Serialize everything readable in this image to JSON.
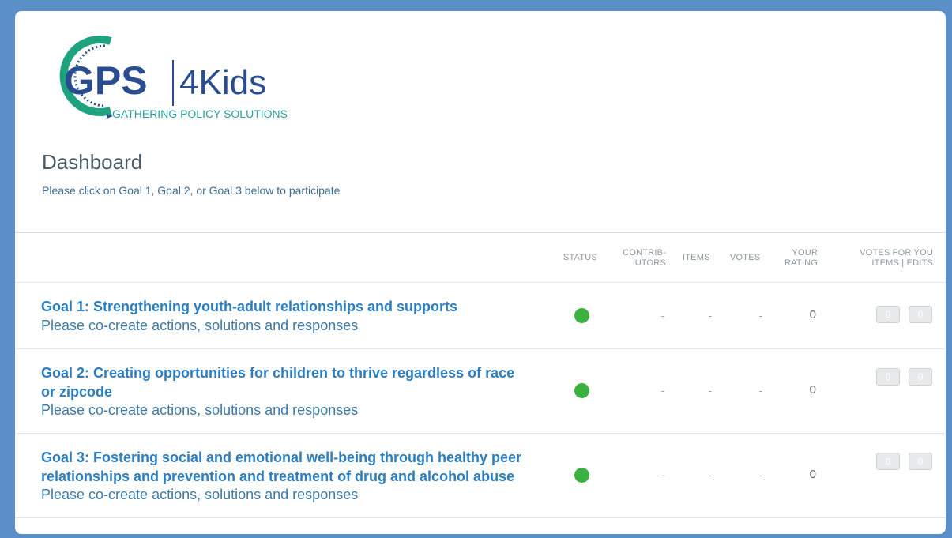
{
  "brand": {
    "logo_main": "GPS",
    "logo_secondary": "4Kids",
    "tagline": "GATHERING POLICY SOLUTIONS",
    "colors": {
      "navy": "#2a4d8f",
      "teal": "#1fa37f",
      "tagline": "#2b9f9d"
    }
  },
  "page": {
    "title": "Dashboard",
    "subtitle": "Please click on Goal 1, Goal 2, or Goal 3 below to participate"
  },
  "table": {
    "headers": {
      "status": "STATUS",
      "contributors_1": "CONTRIB-",
      "contributors_2": "UTORS",
      "items": "ITEMS",
      "votes": "VOTES",
      "rating_1": "YOUR",
      "rating_2": "RATING",
      "votes_for_you_1": "VOTES FOR YOU",
      "votes_for_you_2": "ITEMS | EDITS"
    },
    "rows": [
      {
        "title_line1": "Goal 1: Strengthening youth-adult relationships and supports",
        "title_line2": "",
        "subtitle": "Please co-create actions, solutions and responses",
        "status": "green",
        "contributors": "-",
        "items": "-",
        "votes": "-",
        "rating": "0",
        "votes_items": "0",
        "votes_edits": "0"
      },
      {
        "title_line1": "Goal 2: Creating opportunities for children to thrive regardless of race",
        "title_line2": "or zipcode",
        "subtitle": "Please co-create actions, solutions and responses",
        "status": "green",
        "contributors": "-",
        "items": "-",
        "votes": "-",
        "rating": "0",
        "votes_items": "0",
        "votes_edits": "0"
      },
      {
        "title_line1": "Goal 3: Fostering social and emotional well-being through healthy peer",
        "title_line2": "relationships and prevention and treatment of drug and alcohol abuse",
        "subtitle": "Please co-create actions, solutions and responses",
        "status": "green",
        "contributors": "-",
        "items": "-",
        "votes": "-",
        "rating": "0",
        "votes_items": "0",
        "votes_edits": "0"
      }
    ]
  },
  "status_color": "#3bb23f"
}
